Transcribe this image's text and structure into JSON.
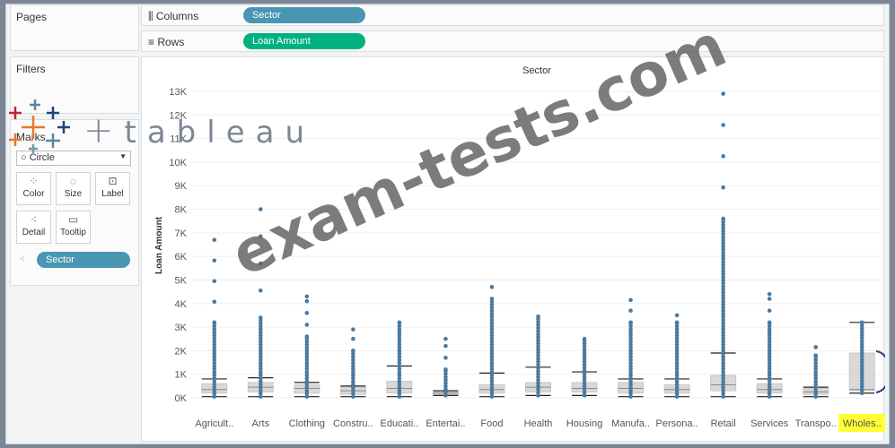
{
  "pages": {
    "title": "Pages"
  },
  "filters": {
    "title": "Filters"
  },
  "marks": {
    "title": "Marks",
    "mark_type": "Circle",
    "buttons": [
      "Color",
      "Size",
      "Label",
      "Detail",
      "Tooltip"
    ],
    "detail_pill": "Sector"
  },
  "shelves": {
    "columns_label": "Columns",
    "columns_pill": "Sector",
    "rows_label": "Rows",
    "rows_pill": "Loan Amount"
  },
  "logo": {
    "text": "tableau"
  },
  "watermark": "exam-tests.com",
  "colors": {
    "dots": "#4a7aa0",
    "whisker": "#222222",
    "box": "#d9d9d9",
    "columns_pill": "#4996b2",
    "rows_pill": "#00b180",
    "highlight": "#ffff33",
    "bracket": "#2b3a8a"
  },
  "chart_data": {
    "type": "scatter",
    "title": "Sector",
    "ylabel": "Loan Amount",
    "ylim": [
      0,
      13000
    ],
    "yticks": [
      "0K",
      "1K",
      "2K",
      "3K",
      "4K",
      "5K",
      "6K",
      "7K",
      "8K",
      "9K",
      "10K",
      "11K",
      "12K",
      "13K"
    ],
    "categories": [
      "Agricult..",
      "Arts",
      "Clothing",
      "Constru..",
      "Educati..",
      "Entertai..",
      "Food",
      "Health",
      "Housing",
      "Manufa..",
      "Persona..",
      "Retail",
      "Services",
      "Transpo..",
      "Wholes.."
    ],
    "highlighted_category": "Wholes..",
    "boxplot": [
      {
        "whisker_low": 50,
        "q1": 200,
        "median": 350,
        "q3": 600,
        "whisker_high": 800,
        "max": 6700
      },
      {
        "whisker_low": 50,
        "q1": 250,
        "median": 450,
        "q3": 650,
        "whisker_high": 850,
        "max": 8000
      },
      {
        "whisker_low": 50,
        "q1": 200,
        "median": 400,
        "q3": 550,
        "whisker_high": 650,
        "max": 4300
      },
      {
        "whisker_low": 50,
        "q1": 150,
        "median": 300,
        "q3": 450,
        "whisker_high": 500,
        "max": 2900
      },
      {
        "whisker_low": 50,
        "q1": 200,
        "median": 400,
        "q3": 700,
        "whisker_high": 1350,
        "max": 3200
      },
      {
        "whisker_low": 100,
        "q1": 150,
        "median": 200,
        "q3": 250,
        "whisker_high": 300,
        "max": 2500
      },
      {
        "whisker_low": 50,
        "q1": 200,
        "median": 350,
        "q3": 550,
        "whisker_high": 1050,
        "max": 4700
      },
      {
        "whisker_low": 100,
        "q1": 250,
        "median": 450,
        "q3": 650,
        "whisker_high": 1300,
        "max": 3450
      },
      {
        "whisker_low": 100,
        "q1": 250,
        "median": 400,
        "q3": 650,
        "whisker_high": 1100,
        "max": 2500
      },
      {
        "whisker_low": 50,
        "q1": 200,
        "median": 400,
        "q3": 650,
        "whisker_high": 800,
        "max": 4150
      },
      {
        "whisker_low": 50,
        "q1": 200,
        "median": 350,
        "q3": 550,
        "whisker_high": 800,
        "max": 3500
      },
      {
        "whisker_low": 50,
        "q1": 300,
        "median": 550,
        "q3": 950,
        "whisker_high": 1900,
        "max": 12900
      },
      {
        "whisker_low": 50,
        "q1": 200,
        "median": 350,
        "q3": 600,
        "whisker_high": 800,
        "max": 4400
      },
      {
        "whisker_low": 50,
        "q1": 150,
        "median": 250,
        "q3": 400,
        "whisker_high": 450,
        "max": 2150
      },
      {
        "whisker_low": 200,
        "q1": 300,
        "median": 350,
        "q3": 1900,
        "whisker_high": 3200,
        "max": 3200
      }
    ]
  }
}
